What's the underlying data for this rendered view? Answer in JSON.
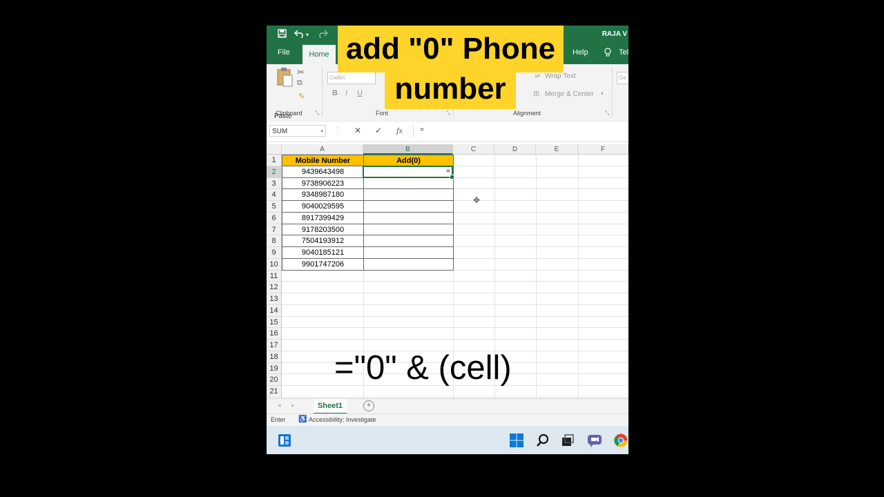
{
  "app": {
    "user_name": "RAJA V"
  },
  "ribbon": {
    "tabs": {
      "file": "File",
      "home": "Home",
      "help": "Help",
      "tell": "Tel"
    },
    "paste_label": "Paste",
    "groups": {
      "clipboard": "Clipboard",
      "font": "Font",
      "alignment": "Alignment"
    },
    "font_name": "Calibri",
    "bold": "B",
    "italic": "I",
    "underline": "U",
    "wrap_text": "Wrap Text",
    "merge_center": "Merge & Center",
    "number_format": "Ge"
  },
  "formula_bar": {
    "name_box": "SUM",
    "formula": "=",
    "cancel": "✕",
    "enter": "✓",
    "fx": "fx"
  },
  "sheet": {
    "columns": [
      "A",
      "B",
      "C",
      "D",
      "E",
      "F"
    ],
    "rows": [
      "1",
      "2",
      "3",
      "4",
      "5",
      "6",
      "7",
      "8",
      "9",
      "10",
      "11",
      "12",
      "13",
      "14",
      "15",
      "16",
      "17",
      "18",
      "19",
      "20",
      "21"
    ],
    "header_a": "Mobile Number",
    "header_b": "Add(0)",
    "mobile_numbers": [
      "9439643498",
      "9738906223",
      "9348987180",
      "9040029595",
      "8917399429",
      "9178203500",
      "7504193912",
      "9040185121",
      "9901747206"
    ],
    "active_cell_content": "="
  },
  "sheet_tabs": {
    "active": "Sheet1",
    "add": "+"
  },
  "status": {
    "mode": "Enter",
    "accessibility": "Accessibility: Investigate"
  },
  "overlay": {
    "title_line1": "add \"0\" Phone",
    "title_line2": "number",
    "formula_hint": "=\"0\" & (cell)"
  },
  "colors": {
    "excel_green": "#217346",
    "banner_yellow": "#ffd42a",
    "header_fill": "#ffc000"
  }
}
